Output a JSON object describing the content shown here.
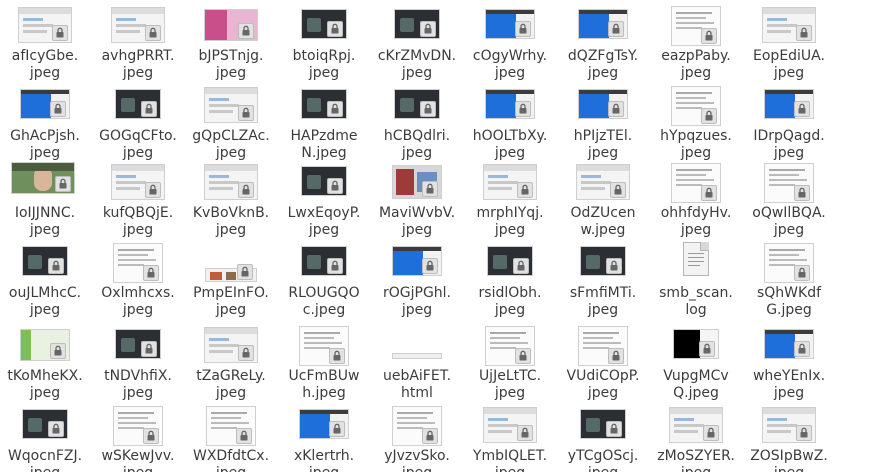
{
  "files": [
    {
      "name": "afIcyGbe.\njpeg",
      "style": "ui"
    },
    {
      "name": "avhgPRRT.\njpeg",
      "style": "ui"
    },
    {
      "name": "bJPSTnjg.\njpeg",
      "style": "pink"
    },
    {
      "name": "btoiqRpj.\njpeg",
      "style": "dark"
    },
    {
      "name": "cKrZMvDN.\njpeg",
      "style": "dark"
    },
    {
      "name": "cOgyWrhy.\njpeg",
      "style": "blue"
    },
    {
      "name": "dQZFgTsY.\njpeg",
      "style": "blue"
    },
    {
      "name": "eazpPaby.\njpeg",
      "style": "doc"
    },
    {
      "name": "EopEdiUA.\njpeg",
      "style": "ui"
    },
    {
      "name": "GhAcPjsh.\njpeg",
      "style": "blue"
    },
    {
      "name": "GOGqCFto.\njpeg",
      "style": "dark"
    },
    {
      "name": "gQpCLZAc.\njpeg",
      "style": "ui"
    },
    {
      "name": "HAPzdme\nN.jpeg",
      "style": "dark"
    },
    {
      "name": "hCBQdlri.\njpeg",
      "style": "dark"
    },
    {
      "name": "hOOLTbXy.\njpeg",
      "style": "blue"
    },
    {
      "name": "hPIjzTEl.\njpeg",
      "style": "blue"
    },
    {
      "name": "hYpqzues.\njpeg",
      "style": "doc"
    },
    {
      "name": "IDrpQagd.\njpeg",
      "style": "blue"
    },
    {
      "name": "IoIJJNNC.\njpeg",
      "style": "photo"
    },
    {
      "name": "kufQBQjE.\njpeg",
      "style": "ui"
    },
    {
      "name": "KvBoVknB.\njpeg",
      "style": "ui"
    },
    {
      "name": "LwxEqoyP.\njpeg",
      "style": "dark"
    },
    {
      "name": "MaviWvbV.\njpeg",
      "style": "mixed"
    },
    {
      "name": "mrphIYqj.\njpeg",
      "style": "ui"
    },
    {
      "name": "OdZUcen\nw.jpeg",
      "style": "ui"
    },
    {
      "name": "ohhfdyHv.\njpeg",
      "style": "doc"
    },
    {
      "name": "oQwIlBQA.\njpeg",
      "style": "doc"
    },
    {
      "name": "ouJLMhcC.\njpeg",
      "style": "dark"
    },
    {
      "name": "Oxlmhcxs.\njpeg",
      "style": "doc"
    },
    {
      "name": "PmpEInFO.\njpeg",
      "style": "thin"
    },
    {
      "name": "RLOUGQO\nc.jpeg",
      "style": "dark"
    },
    {
      "name": "rOGjPGhl.\njpeg",
      "style": "blue"
    },
    {
      "name": "rsidlObh.\njpeg",
      "style": "dark"
    },
    {
      "name": "sFmfiMTi.\njpeg",
      "style": "dark"
    },
    {
      "name": "smb_scan.\nlog",
      "style": "textfile"
    },
    {
      "name": "sQhWKdf\nG.jpeg",
      "style": "doc"
    },
    {
      "name": "tKoMheKX.\njpeg",
      "style": "green"
    },
    {
      "name": "tNDVhfiX.\njpeg",
      "style": "dark"
    },
    {
      "name": "tZaGReLy.\njpeg",
      "style": "ui"
    },
    {
      "name": "UcFmBUw\nh.jpeg",
      "style": "doc"
    },
    {
      "name": "uebAiFET.\nhtml",
      "style": "html"
    },
    {
      "name": "UjJeLtTC.\njpeg",
      "style": "doc"
    },
    {
      "name": "VUdiCOpP.\njpeg",
      "style": "doc"
    },
    {
      "name": "VupgMCv\nQ.jpeg",
      "style": "blackwhite"
    },
    {
      "name": "wheYEnIx.\njpeg",
      "style": "blue"
    },
    {
      "name": "WqocnFZJ.\njpeg",
      "style": "dark"
    },
    {
      "name": "wSKewJvv.\njpeg",
      "style": "doc"
    },
    {
      "name": "WXDfdtCx.\njpeg",
      "style": "doc"
    },
    {
      "name": "xKlertrh.\njpeg",
      "style": "blue"
    },
    {
      "name": "yJvzvSko.\njpeg",
      "style": "doc"
    },
    {
      "name": "YmbIQLET.\njpeg",
      "style": "ui"
    },
    {
      "name": "yTCgOScj.\njpeg",
      "style": "dark"
    },
    {
      "name": "zMoSZYER.\njpeg",
      "style": "ui"
    },
    {
      "name": "ZOSIpBwZ.\njpeg",
      "style": "ui"
    }
  ],
  "colors": {
    "label_text": "#3c3c3c",
    "lock_bg": "#e2e2e2",
    "ubuntu_blue": "#1e6fd9",
    "dark_bg": "#2b2f33"
  },
  "icons": {
    "overlay": "lock-icon",
    "textfile": "text-document-icon"
  }
}
